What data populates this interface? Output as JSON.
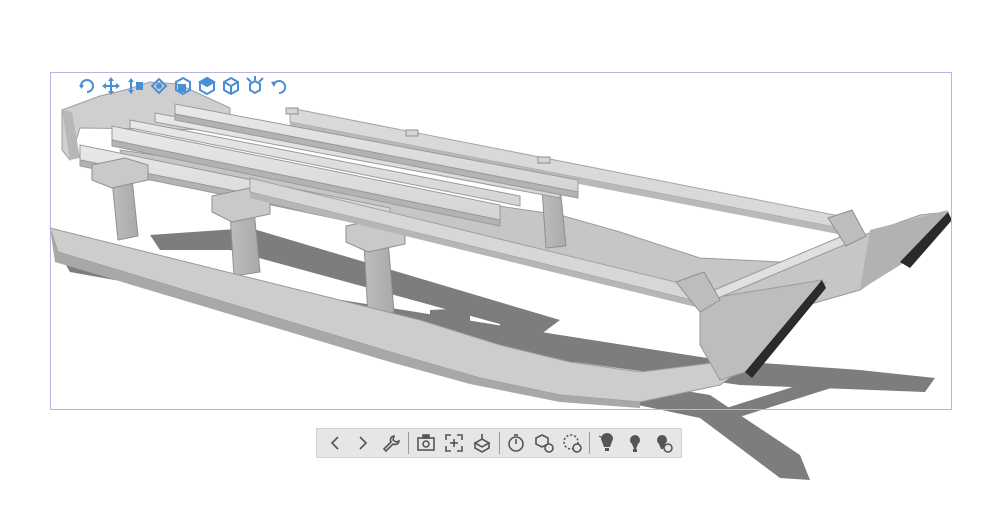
{
  "viewer": {
    "model_name": "sled-3d-model",
    "accent_color": "#4a8fd6",
    "frame_color": "#b9b4e6",
    "toolbar_bg": "#e6e6e6",
    "icon_color": "#555555"
  },
  "view_toolbar": {
    "icons": [
      "orbit-icon",
      "pan-icon",
      "zoom-icon",
      "fit-view-icon",
      "front-view-icon",
      "top-view-icon",
      "iso-view-icon",
      "explode-icon",
      "undo-icon"
    ]
  },
  "bottom_toolbar": {
    "icons": [
      "previous-icon",
      "next-icon",
      "settings-wrench-icon",
      "screenshot-icon",
      "fit-all-icon",
      "measure-icon",
      "timer-icon",
      "parts-info-icon",
      "rotate-timer-icon",
      "light-top-icon",
      "light-spot-icon",
      "light-settings-icon"
    ]
  }
}
